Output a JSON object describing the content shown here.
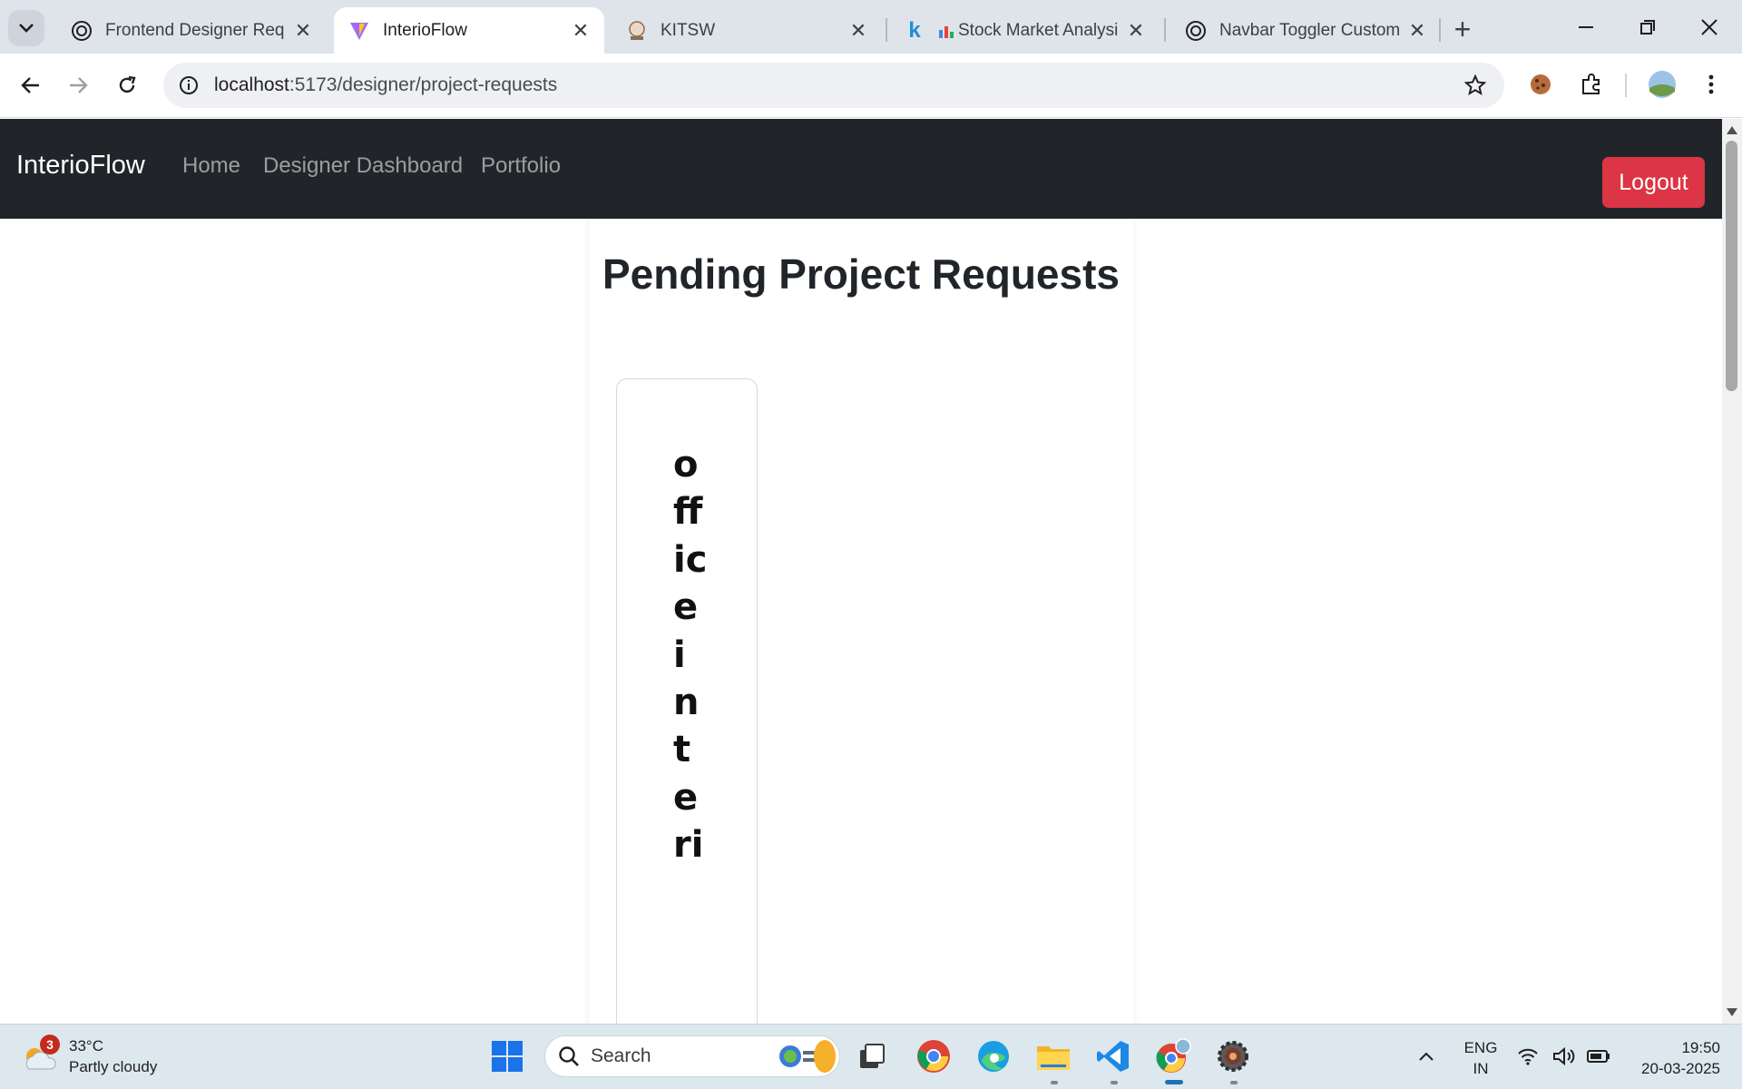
{
  "browser": {
    "tabs": [
      {
        "title": "Frontend Designer Reque",
        "favicon": "openai-icon",
        "active": false
      },
      {
        "title": "InterioFlow",
        "favicon": "vite-icon",
        "active": true
      },
      {
        "title": "KITSW",
        "favicon": "kitsw-icon",
        "active": false
      },
      {
        "title": "Stock Market Analysis",
        "favicon": "k-icon",
        "active": false
      },
      {
        "title": "Navbar Toggler Customiz",
        "favicon": "openai-icon",
        "active": false
      }
    ],
    "url_host": "localhost",
    "url_path": ":5173/designer/project-requests"
  },
  "navbar": {
    "brand": "InterioFlow",
    "links": [
      "Home",
      "Designer Dashboard",
      "Portfolio"
    ],
    "logout_label": "Logout"
  },
  "main": {
    "title": "Pending Project Requests",
    "request_cards": [
      {
        "title": "officeinteri"
      }
    ]
  },
  "taskbar": {
    "weather_badge": "3",
    "temperature": "33°C",
    "condition": "Partly cloudy",
    "search_label": "Search",
    "language_line1": "ENG",
    "language_line2": "IN",
    "time": "19:50",
    "date": "20-03-2025"
  },
  "colors": {
    "navbar_bg": "#212529",
    "logout_bg": "#dc3545",
    "tabstrip_bg": "#dfe3ea"
  }
}
